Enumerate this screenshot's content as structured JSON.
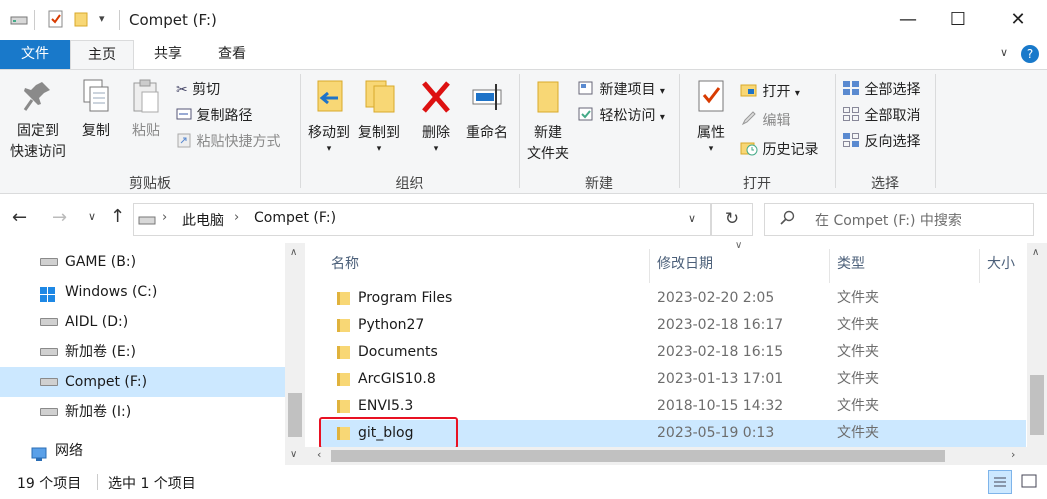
{
  "window": {
    "title": "Compet (F:)",
    "controls": {
      "minimize": "—",
      "maximize": "☐",
      "close": "✕"
    }
  },
  "tabs": [
    {
      "label": "文件"
    },
    {
      "label": "主页"
    },
    {
      "label": "共享"
    },
    {
      "label": "查看"
    }
  ],
  "ribbon": {
    "clipboard": {
      "pin_label_1": "固定到",
      "pin_label_2": "快速访问",
      "copy": "复制",
      "paste": "粘贴",
      "cut": "剪切",
      "copy_path": "复制路径",
      "paste_shortcut": "粘贴快捷方式",
      "group_label": "剪贴板"
    },
    "organize": {
      "move_to": "移动到",
      "copy_to": "复制到",
      "delete": "删除",
      "rename": "重命名",
      "group_label": "组织"
    },
    "new": {
      "new_folder_1": "新建",
      "new_folder_2": "文件夹",
      "new_item": "新建项目",
      "easy_access": "轻松访问",
      "group_label": "新建"
    },
    "open": {
      "properties": "属性",
      "open": "打开",
      "edit": "编辑",
      "history": "历史记录",
      "group_label": "打开"
    },
    "select": {
      "select_all": "全部选择",
      "select_none": "全部取消",
      "invert": "反向选择",
      "group_label": "选择"
    }
  },
  "address": {
    "crumbs": [
      "此电脑",
      "Compet (F:)"
    ],
    "search_placeholder": "在 Compet (F:) 中搜索"
  },
  "nav": {
    "items": [
      {
        "label": "GAME (B:)",
        "selected": false
      },
      {
        "label": "Windows (C:)",
        "selected": false
      },
      {
        "label": "AIDL (D:)",
        "selected": false
      },
      {
        "label": "新加卷 (E:)",
        "selected": false
      },
      {
        "label": "Compet (F:)",
        "selected": true
      },
      {
        "label": "新加卷 (I:)",
        "selected": false
      }
    ],
    "network": "网络"
  },
  "filelist": {
    "columns": [
      "名称",
      "修改日期",
      "类型",
      "大小"
    ],
    "rows": [
      {
        "name": "Program Files",
        "date": "2023-02-20 2:05",
        "type": "文件夹"
      },
      {
        "name": "Python27",
        "date": "2023-02-18 16:17",
        "type": "文件夹"
      },
      {
        "name": "Documents",
        "date": "2023-02-18 16:15",
        "type": "文件夹"
      },
      {
        "name": "ArcGIS10.8",
        "date": "2023-01-13 17:01",
        "type": "文件夹"
      },
      {
        "name": "ENVI5.3",
        "date": "2018-10-15 14:32",
        "type": "文件夹"
      },
      {
        "name": "git_blog",
        "date": "2023-05-19 0:13",
        "type": "文件夹",
        "selected": true
      }
    ]
  },
  "status": {
    "item_count": "19 个项目",
    "selected_count": "选中 1 个项目"
  },
  "colors": {
    "accent": "#1979ca",
    "selection": "#cce8ff",
    "highlight_box": "#e81123"
  }
}
